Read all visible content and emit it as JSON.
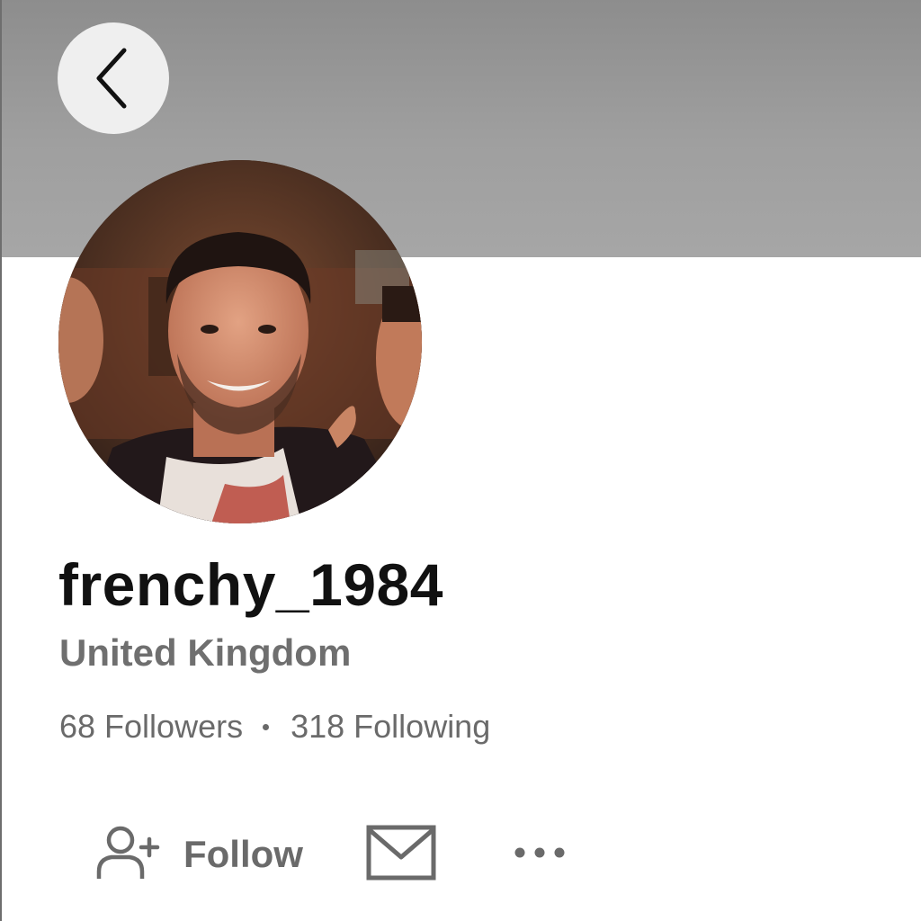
{
  "header": {
    "back_icon": "chevron-left-icon",
    "cover_color": "#9a9a9a"
  },
  "profile": {
    "avatar_icon": "profile-photo",
    "username": "frenchy_1984",
    "location": "United Kingdom",
    "followers_label": "68 Followers",
    "following_label": "318 Following"
  },
  "actions": {
    "follow_icon": "add-user-icon",
    "follow_label": "Follow",
    "message_icon": "envelope-icon",
    "more_icon": "more-horizontal-icon"
  },
  "colors": {
    "text_primary": "#111111",
    "text_secondary": "#6a6a6a",
    "back_button_bg": "#efefef"
  }
}
